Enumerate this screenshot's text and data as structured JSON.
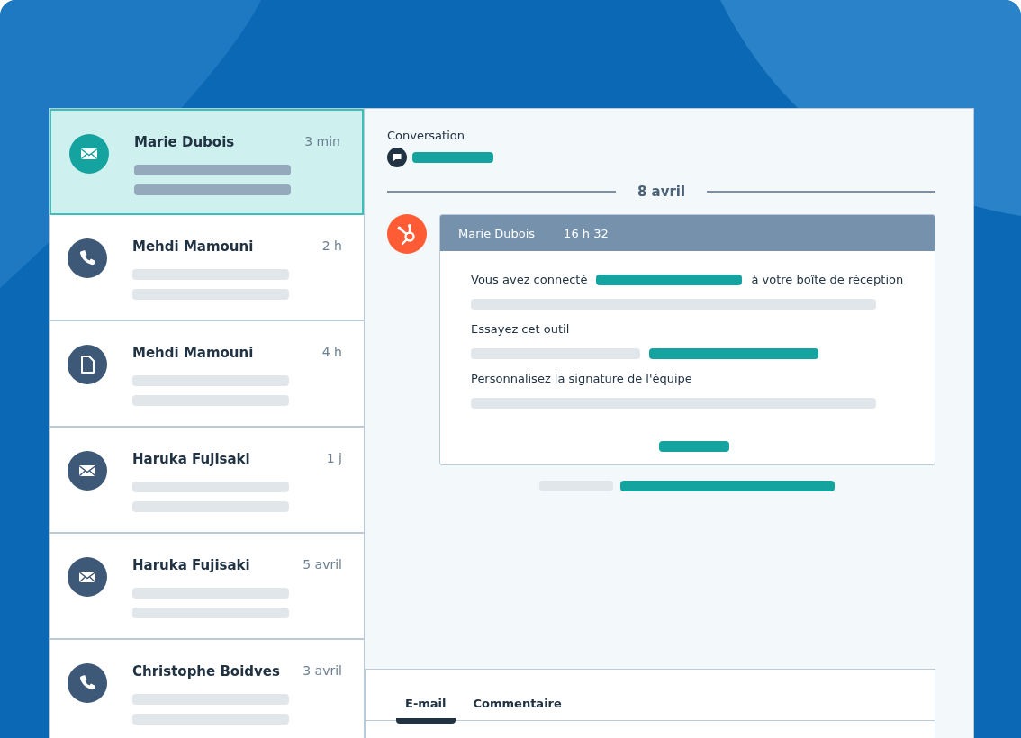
{
  "conversations": [
    {
      "name": "Marie Dubois",
      "time": "3 min",
      "kind": "email",
      "selected": true
    },
    {
      "name": "Mehdi Mamouni",
      "time": "2 h",
      "kind": "phone",
      "selected": false
    },
    {
      "name": "Mehdi Mamouni",
      "time": "4 h",
      "kind": "document",
      "selected": false
    },
    {
      "name": "Haruka Fujisaki",
      "time": "1 j",
      "kind": "email",
      "selected": false
    },
    {
      "name": "Haruka Fujisaki",
      "time": "5 avril",
      "kind": "email",
      "selected": false
    },
    {
      "name": "Christophe Boidves",
      "time": "3 avril",
      "kind": "phone",
      "selected": false
    }
  ],
  "thread": {
    "title": "Conversation",
    "date": "8 avril",
    "message": {
      "sender": "Marie Dubois",
      "time": "16 h 32",
      "sections": [
        {
          "kind": "connected",
          "before": "Vous avez connecté",
          "after": "à votre boîte de réception"
        },
        {
          "kind": "tool",
          "text": "Essayez cet outil"
        },
        {
          "kind": "plain",
          "text": "Personnalisez la signature de l'équipe"
        }
      ]
    }
  },
  "composer": {
    "tabs": [
      {
        "label": "E-mail",
        "selected": true
      },
      {
        "label": "Commentaire",
        "selected": false
      }
    ]
  }
}
